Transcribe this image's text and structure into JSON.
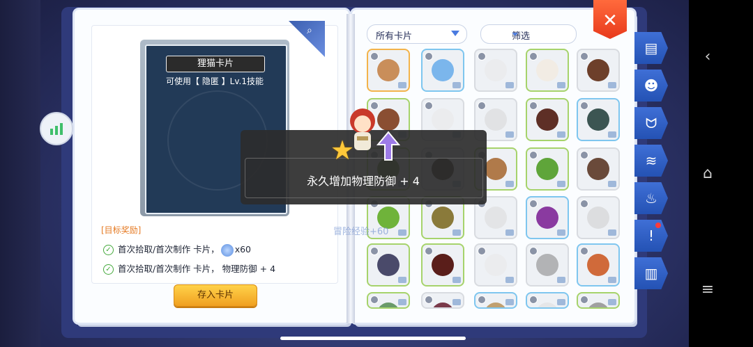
{
  "left_card": {
    "name": "狸猫卡片",
    "description": "可使用【 隐匿 】Lv.1技能"
  },
  "rewards": {
    "title": "[目标奖励]",
    "rows": [
      {
        "text": "首次拾取/首次制作 卡片，",
        "suffix": "x60"
      },
      {
        "text": "首次拾取/首次制作 卡片， 物理防御 + 4",
        "suffix": ""
      }
    ]
  },
  "store_button_label": "存入卡片",
  "right_page": {
    "dropdown_label": "所有卡片",
    "filter_label": "筛选"
  },
  "close_icon": "close-icon",
  "popup": {
    "message": "永久增加物理防御 + 4",
    "exp_bg_text": "冒险经验+60"
  },
  "grid": [
    {
      "color": "#c98e5a",
      "border": "#f3b34a",
      "bright": true
    },
    {
      "color": "#7bb6ec",
      "border": "#7ec6ef",
      "bright": true
    },
    {
      "color": "#e9e9e9",
      "border": "#d8dbe0",
      "bright": false
    },
    {
      "color": "#f2ece4",
      "border": "#a6d36b",
      "bright": true
    },
    {
      "color": "#6d3f2a",
      "border": "#d8dbe0",
      "bright": true
    },
    {
      "color": "#8a4e32",
      "border": "#a6d36b",
      "bright": true
    },
    {
      "color": "#e9e9e9",
      "border": "#d8dbe0",
      "bright": false
    },
    {
      "color": "#d9d9d9",
      "border": "#d8dbe0",
      "bright": false
    },
    {
      "color": "#5e2f26",
      "border": "#a6d36b",
      "bright": true
    },
    {
      "color": "#3c5552",
      "border": "#7ec6ef",
      "bright": true
    },
    {
      "color": "#6b8a3a",
      "border": "#a6d36b",
      "bright": true
    },
    {
      "color": "#3a2a22",
      "border": "#d8dbe0",
      "bright": true
    },
    {
      "color": "#b07a4a",
      "border": "#a6d36b",
      "bright": true
    },
    {
      "color": "#5fa53a",
      "border": "#a6d36b",
      "bright": true
    },
    {
      "color": "#6a4a3a",
      "border": "#d8dbe0",
      "bright": true
    },
    {
      "color": "#6fb33a",
      "border": "#a6d36b",
      "bright": true
    },
    {
      "color": "#8a7a3a",
      "border": "#a6d36b",
      "bright": true
    },
    {
      "color": "#dcdcdc",
      "border": "#d8dbe0",
      "bright": false
    },
    {
      "color": "#8a3aa0",
      "border": "#7ec6ef",
      "bright": true
    },
    {
      "color": "#d0d0d0",
      "border": "#d8dbe0",
      "bright": false
    },
    {
      "color": "#4a4a6a",
      "border": "#a6d36b",
      "bright": true
    },
    {
      "color": "#5a1e1a",
      "border": "#a6d36b",
      "bright": true
    },
    {
      "color": "#e9e9e9",
      "border": "#d8dbe0",
      "bright": false
    },
    {
      "color": "#8a8a8a",
      "border": "#d8dbe0",
      "bright": false
    },
    {
      "color": "#d06a3a",
      "border": "#7ec6ef",
      "bright": true
    },
    {
      "color": "#6a9a6a",
      "border": "#a6d36b",
      "bright": true
    },
    {
      "color": "#7a3a4a",
      "border": "#d8dbe0",
      "bright": true
    },
    {
      "color": "#c0a070",
      "border": "#7ec6ef",
      "bright": true
    },
    {
      "color": "#e0e0e0",
      "border": "#7ec6ef",
      "bright": false
    },
    {
      "color": "#a0a0a0",
      "border": "#a6d36b",
      "bright": true
    }
  ],
  "side_tabs": [
    {
      "icon": "card-book-icon"
    },
    {
      "icon": "grin-face-icon"
    },
    {
      "icon": "cat-ears-icon"
    },
    {
      "icon": "fish-icon"
    },
    {
      "icon": "chef-hat-icon"
    },
    {
      "icon": "alert-person-icon",
      "badge": true
    },
    {
      "icon": "open-book-icon"
    }
  ]
}
